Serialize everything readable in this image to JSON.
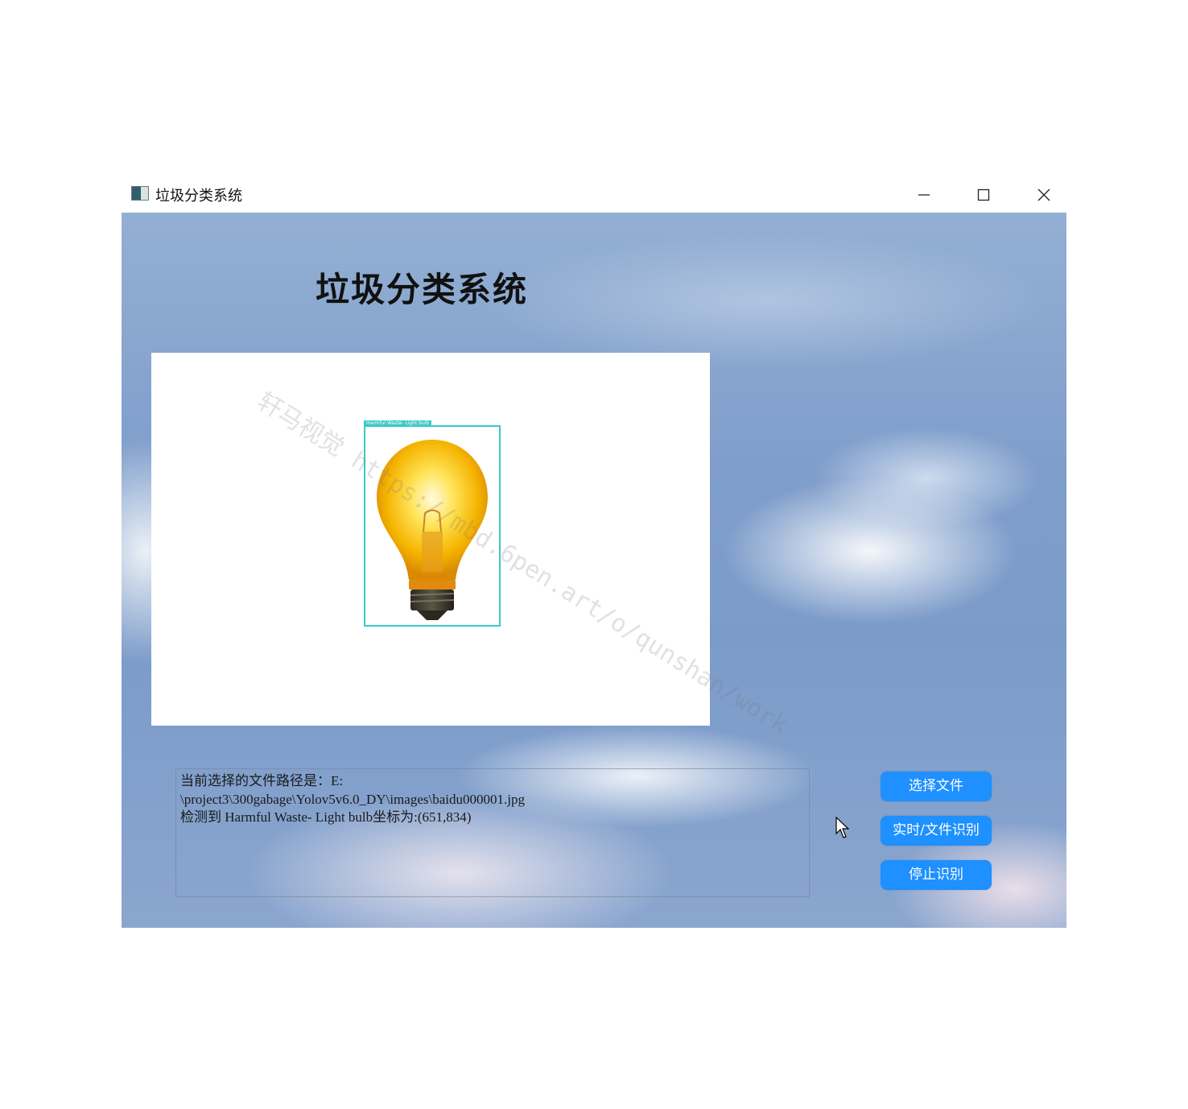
{
  "window": {
    "title": "垃圾分类系统",
    "app_icon": "app-icon"
  },
  "main": {
    "heading": "垃圾分类系统",
    "detection_label": "Harmful Waste- Light bulb",
    "watermark": "轩马视觉 https://mbd.6pen.art/o/qunshan/work"
  },
  "log": {
    "lines": [
      "当前选择的文件路径是：E:",
      "\\project3\\300gabage\\Yolov5v6.0_DY\\images\\baidu000001.jpg",
      "检测到 Harmful Waste- Light bulb坐标为:(651,834)"
    ]
  },
  "buttons": {
    "select_file": "选择文件",
    "realtime_file_detect": "实时/文件识别",
    "stop_detect": "停止识别"
  },
  "colors": {
    "button_bg": "#1e90ff",
    "bbox": "#3cc8c8",
    "sky": "#7f9ecb"
  }
}
